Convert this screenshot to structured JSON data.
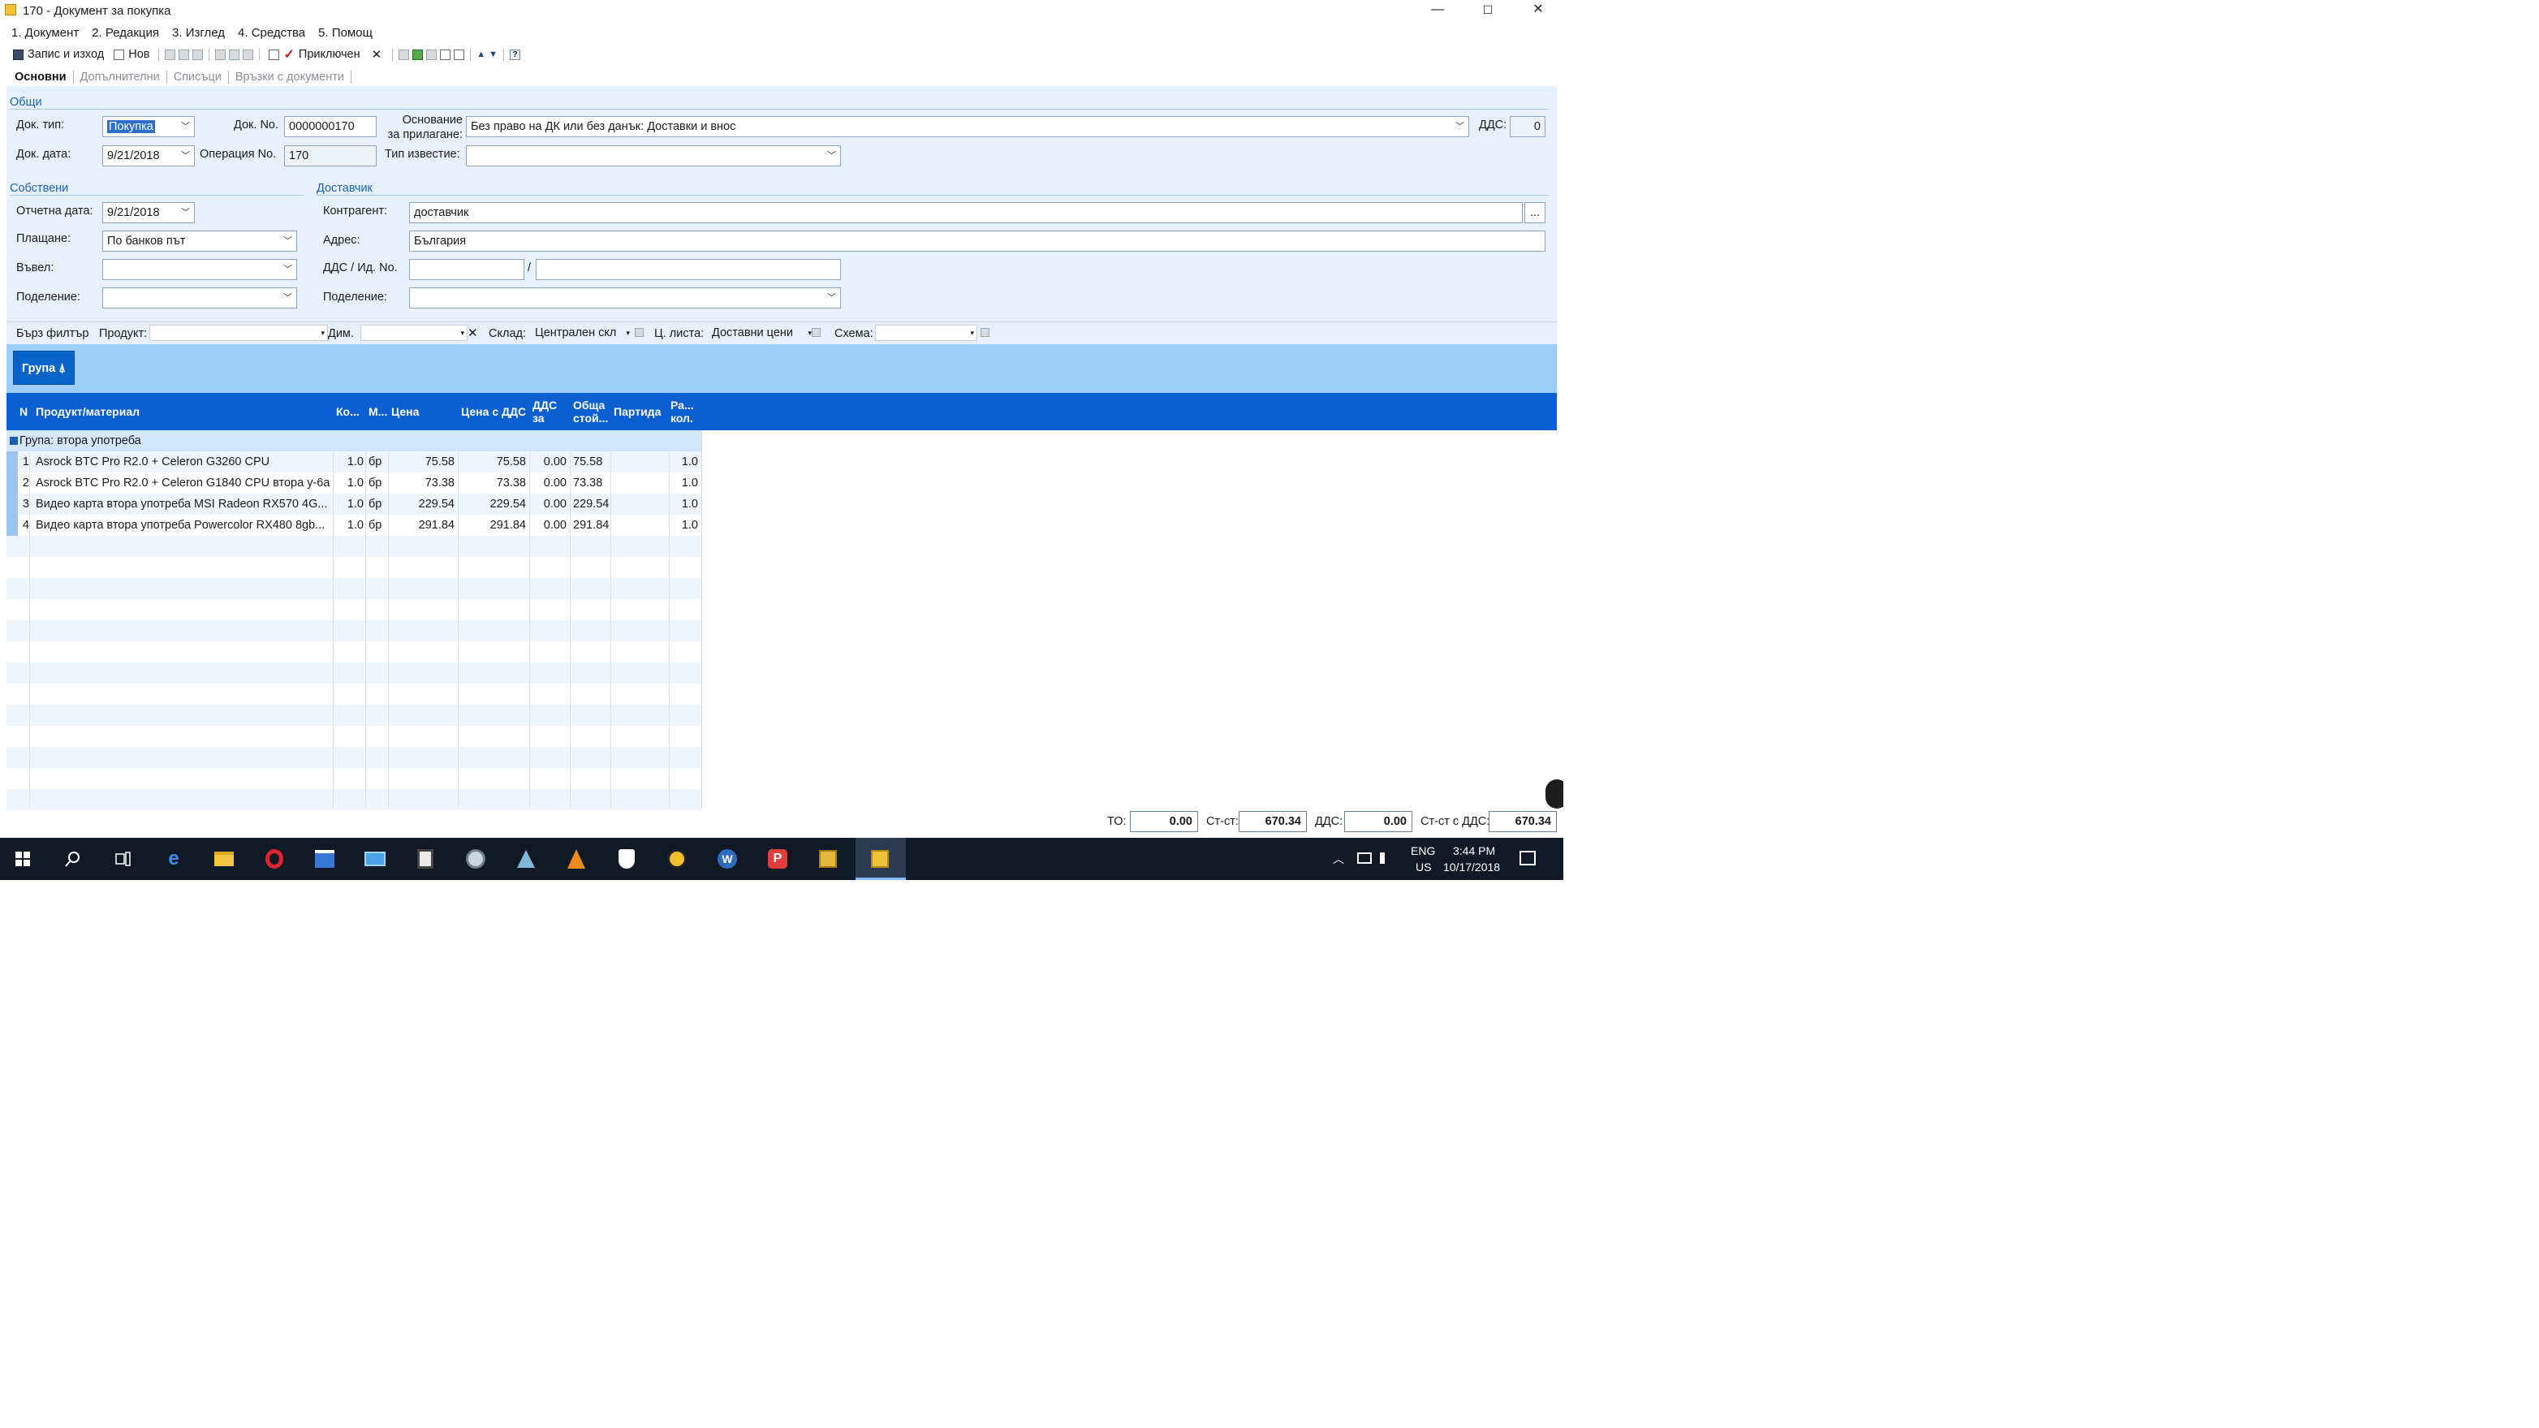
{
  "window": {
    "title": "170 - Документ за покупка",
    "controls": {
      "minimize": "—",
      "maximize": "☐",
      "close": "✕"
    }
  },
  "menu": [
    {
      "label": "1. Документ"
    },
    {
      "label": "2. Редакция"
    },
    {
      "label": "3. Изглед"
    },
    {
      "label": "4. Средства"
    },
    {
      "label": "5. Помощ"
    }
  ],
  "toolbar": {
    "save_exit": "Запис и изход",
    "new": "Нов",
    "completed": "Приключен",
    "checkmark": "✓",
    "close_x": "✕",
    "up_arrow": "▲",
    "down_arrow": "▼",
    "help": "?"
  },
  "tabs": [
    {
      "label": "Основни",
      "active": true
    },
    {
      "label": "Допълнителни",
      "active": false
    },
    {
      "label": "Списъци",
      "active": false
    },
    {
      "label": "Връзки с документи",
      "active": false
    }
  ],
  "general": {
    "section": "Общи",
    "doc_type_label": "Док. тип:",
    "doc_type_value": "Покупка",
    "doc_no_label": "Док. No.",
    "doc_no_value": "0000000170",
    "basis_label_1": "Основание",
    "basis_label_2": "за прилагане:",
    "basis_value": "Без право на ДК или без данък: Доставки и внос",
    "vat_label": "ДДС:",
    "vat_value": "0",
    "doc_date_label": "Док. дата:",
    "doc_date_value": "9/21/2018",
    "operation_no_label": "Операция No.",
    "operation_no_value": "170",
    "notice_type_label": "Тип известие:",
    "notice_type_value": ""
  },
  "own": {
    "section": "Собствени",
    "report_date_label": "Отчетна дата:",
    "report_date_value": "9/21/2018",
    "payment_label": "Плащане:",
    "payment_value": "По банков път",
    "entered_by_label": "Въвел:",
    "entered_by_value": "",
    "division_label": "Поделение:",
    "division_value": ""
  },
  "supplier": {
    "section": "Доставчик",
    "counterparty_label": "Контрагент:",
    "counterparty_value": "доставчик",
    "browse": "...",
    "address_label": "Адрес:",
    "address_value": "България",
    "vat_id_label": "ДДС / Ид. No.",
    "vat_id_value": "",
    "id_sep": "/",
    "id_value": "",
    "division_label": "Поделение:",
    "division_value": ""
  },
  "filter": {
    "quick_filter": "Бърз филтър",
    "product_label": "Продукт:",
    "product_value": "",
    "dim_label": "Дим.",
    "dim_value": "",
    "clear": "✕",
    "warehouse_label": "Склад:",
    "warehouse_value": "Централен скл",
    "price_list_label": "Ц. листа:",
    "price_list_value": "Доставни цени",
    "scheme_label": "Схема:",
    "scheme_value": ""
  },
  "group_chip": "Група ⍋",
  "grid": {
    "headers": {
      "n": "N",
      "product": "Продукт/материал",
      "qty": "Ко...",
      "unit": "М...",
      "price": "Цена",
      "price_vat": "Цена с ДДС",
      "vat_1": "ДДС",
      "vat_2": "за",
      "total_1": "Обща",
      "total_2": "стой...",
      "batch": "Партида",
      "ra_1": "Ра...",
      "ra_2": "кол."
    },
    "group_label": "Група: втора употреба",
    "rows": [
      {
        "n": "1",
        "product": "Asrock BTC Pro R2.0 + Celeron G3260 CPU",
        "qty": "1.0",
        "unit": "бр",
        "price": "75.58",
        "price_vat": "75.58",
        "vat": "0.00",
        "total": "75.58",
        "batch": "",
        "ra": "1.0"
      },
      {
        "n": "2",
        "product": "Asrock BTC Pro R2.0 + Celeron G1840 CPU втора у-6а",
        "qty": "1.0",
        "unit": "бр",
        "price": "73.38",
        "price_vat": "73.38",
        "vat": "0.00",
        "total": "73.38",
        "batch": "",
        "ra": "1.0"
      },
      {
        "n": "3",
        "product": "Видео карта втора употреба MSI Radeon RX570 4G...",
        "qty": "1.0",
        "unit": "бр",
        "price": "229.54",
        "price_vat": "229.54",
        "vat": "0.00",
        "total": "229.54",
        "batch": "",
        "ra": "1.0"
      },
      {
        "n": "4",
        "product": "Видео карта втора употреба Powercolor RX480 8gb...",
        "qty": "1.0",
        "unit": "бр",
        "price": "291.84",
        "price_vat": "291.84",
        "vat": "0.00",
        "total": "291.84",
        "batch": "",
        "ra": "1.0"
      }
    ]
  },
  "totals": {
    "to_label": "ТО:",
    "to_value": "0.00",
    "cost_label": "Ст-ст:",
    "cost_value": "670.34",
    "vat_label": "ДДС:",
    "vat_value": "0.00",
    "cost_vat_label": "Ст-ст с ДДС:",
    "cost_vat_value": "670.34"
  },
  "taskbar": {
    "lang_1": "ENG",
    "lang_2": "US",
    "time": "3:44 PM",
    "date": "10/17/2018",
    "icons": [
      "windows-start",
      "search",
      "task-view",
      "edge",
      "file-explorer",
      "opera",
      "store",
      "remote-desktop",
      "calculator",
      "steam",
      "paint",
      "vlc",
      "defender",
      "coin-app",
      "word",
      "pocket-casts",
      "folder-app",
      "active-app"
    ]
  },
  "colors": {
    "form_bg": "#e6f1fb",
    "grid_header": "#0b5fd0",
    "group_zone": "#9ecdf9",
    "accent_blue": "#1d63b5",
    "taskbar": "#101a27"
  }
}
